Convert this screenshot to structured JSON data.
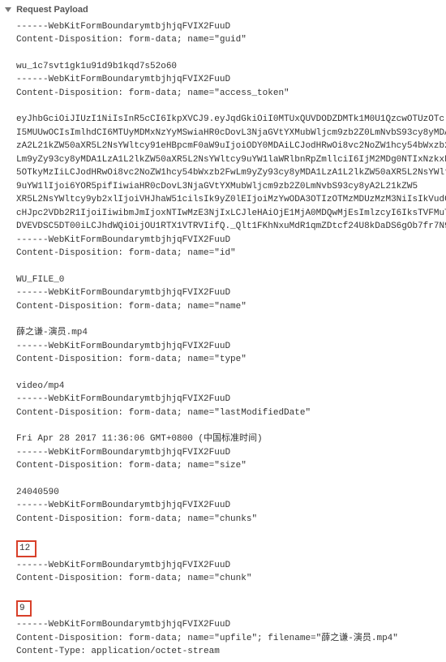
{
  "header": {
    "title": "Request Payload"
  },
  "boundary": "------WebKitFormBoundarymtbjhjqFVIX2FuuD",
  "parts": {
    "guid": {
      "cd": "Content-Disposition: form-data; name=\"guid\"",
      "value": "wu_1c7svt1gk1u91d9b1kqd7s52o60"
    },
    "access_token": {
      "cd": "Content-Disposition: form-data; name=\"access_token\"",
      "line1": "eyJhbGciOiJIUzI1NiIsInR5cCI6IkpXVCJ9.eyJqdGkiOiI0MTUxQUVDODZDMTk1M0U1QzcwOTUzOTc",
      "line2": "I5MUUwOCIsImlhdCI6MTUyMDMxNzYyMSwiaHR0cDovL3NjaGVtYXMubWljcm9zb2Z0LmNvbS93cy8yMDA",
      "line3": "zA2L21kZW50aXR5L2NsYWltcy91eHBpcmF0aW9uIjoiODY0MDAiLCJodHRwOi8vc2NoZW1hcy54bWxzb2",
      "line4": "Lm9yZy93cy8yMDA1LzA1L2lkZW50aXR5L2NsYWltcy9uYW1laWRlbnRpZmllciI6IjM2MDg0NTIxNzkxN",
      "line5": "5OTkyMzIiLCJodHRwOi8vc2NoZW1hcy54bWxzb2FwLm9yZy93cy8yMDA1LzA1L2lkZW50aXR5L2NsYWlt",
      "line6": "9uYW1lIjoi6YOR5pifIiwiaHR0cDovL3NjaGVtYXMubWljcm9zb2Z0LmNvbS93cy8yA2L21kZW5",
      "line7": "XR5L2NsYWltcy9yb2xlIjoiVHJhaW51cilsIk9yZ0lEIjoiMzYwODA3OTIzOTMzMDUzMzM3NiIsIkVudG",
      "line8": "cHJpc2VDb2R1IjoiIiwibmJmIjoxNTIwMzE3NjIxLCJleHAiOjE1MjA0MDQwMjEsImlzcyI6IksTVFMuT",
      "line9": "DVEVDSC5DT00iLCJhdWQiOijOU1RTX1VTRVIifQ._Qlt1FKhNxuMdR1qmZDtcf24U8kDaDS6gOb7fr7N9"
    },
    "id": {
      "cd": "Content-Disposition: form-data; name=\"id\"",
      "value": "WU_FILE_0"
    },
    "name": {
      "cd": "Content-Disposition: form-data; name=\"name\"",
      "value": "薛之谦-演员.mp4"
    },
    "type": {
      "cd": "Content-Disposition: form-data; name=\"type\"",
      "value": "video/mp4"
    },
    "lastModifiedDate": {
      "cd": "Content-Disposition: form-data; name=\"lastModifiedDate\"",
      "value": "Fri Apr 28 2017 11:36:06 GMT+0800 (中国标准时间)"
    },
    "size": {
      "cd": "Content-Disposition: form-data; name=\"size\"",
      "value": "24040590"
    },
    "chunks": {
      "cd": "Content-Disposition: form-data; name=\"chunks\"",
      "value": "12"
    },
    "chunk": {
      "cd": "Content-Disposition: form-data; name=\"chunk\"",
      "value": "9"
    },
    "upfile": {
      "cd": "Content-Disposition: form-data; name=\"upfile\"; filename=\"薛之谦-演员.mp4\"",
      "ct": "Content-Type: application/octet-stream"
    }
  }
}
